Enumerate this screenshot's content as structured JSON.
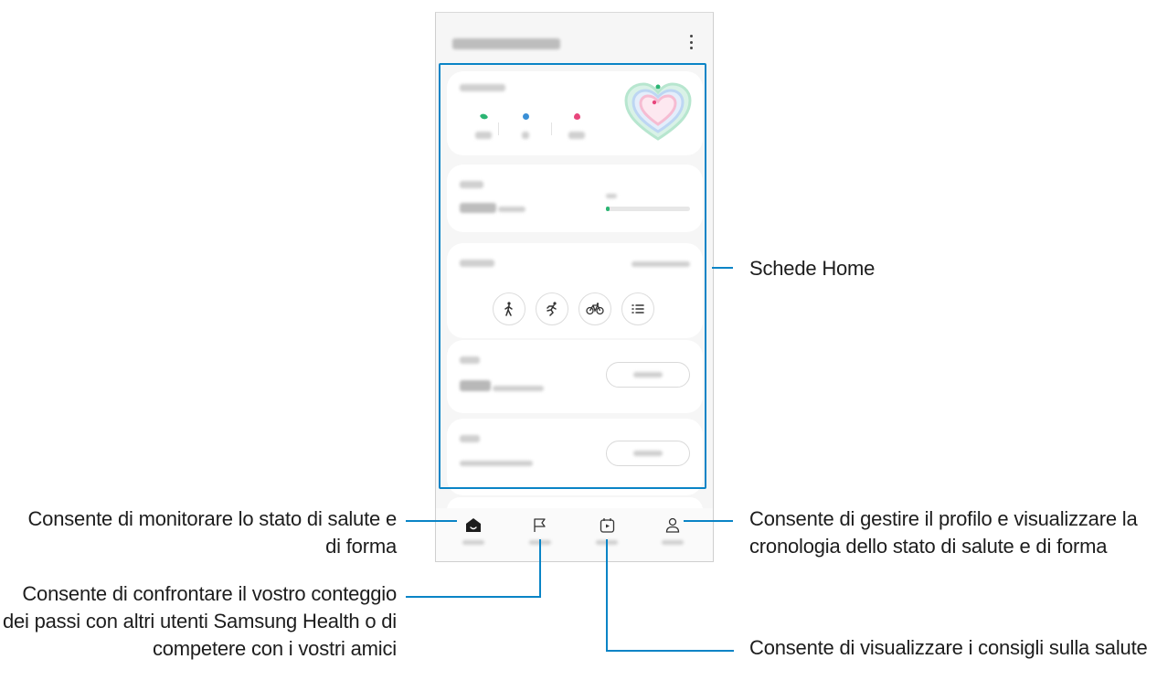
{
  "callouts": {
    "home_cards": "Schede Home",
    "home_tab": "Consente di monitorare lo stato di salute e di forma",
    "together_tab": "Consente di confrontare il vostro conteggio dei passi con altri utenti Samsung Health o di competere con i vostri amici",
    "discover_tab": "Consente di visualizzare i consigli sulla salute",
    "profile_tab": "Consente di gestire il profilo e visualizzare la cronologia dello stato di salute e di forma"
  },
  "icons": {
    "more": "more-vert-icon",
    "steps": "footprint-icon",
    "active_time": "clock-dot-icon",
    "calories": "flame-icon",
    "walk": "walk-icon",
    "run": "run-icon",
    "bike": "bike-icon",
    "list": "list-icon",
    "home": "home-icon",
    "together": "flag-icon",
    "discover": "play-calendar-icon",
    "profile": "person-icon"
  },
  "steps_progress": 0.03,
  "colors": {
    "accent_line": "#0a84c6",
    "steps": "#2bb573",
    "active_time": "#3a8fd6",
    "calories": "#e8467c"
  }
}
